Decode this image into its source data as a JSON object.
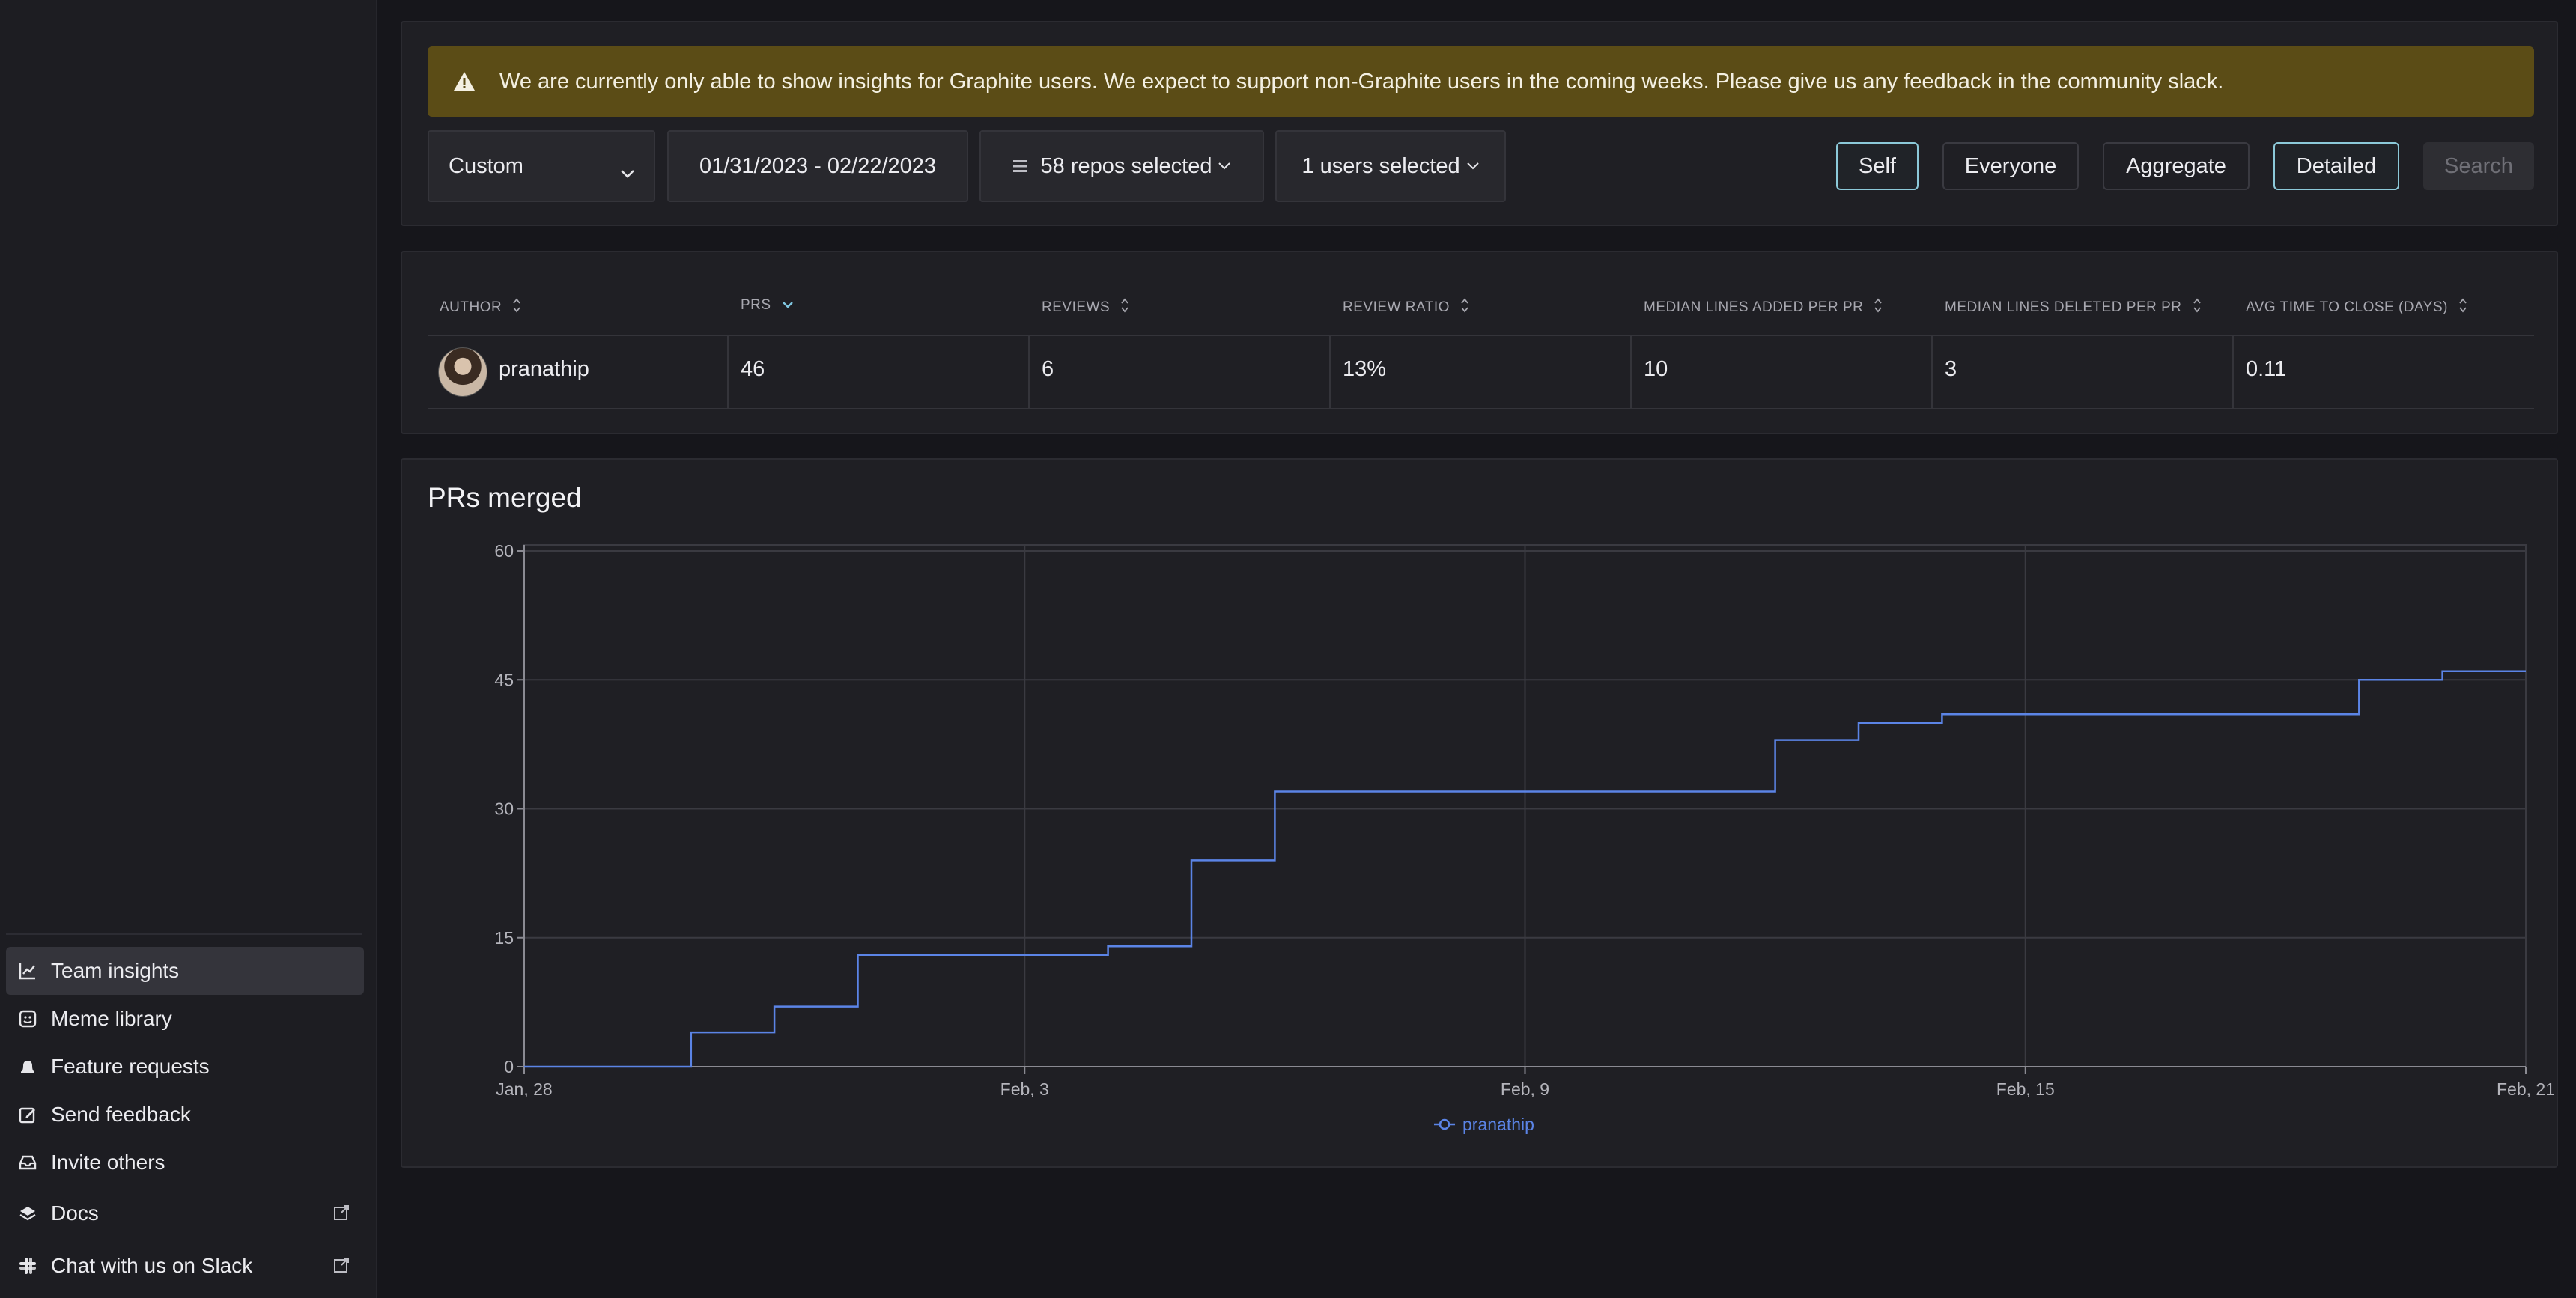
{
  "sidebar": {
    "items": [
      {
        "label": "Team insights",
        "icon": "chart-line-icon",
        "active": true
      },
      {
        "label": "Meme library",
        "icon": "meme-icon",
        "active": false
      },
      {
        "label": "Feature requests",
        "icon": "bell-icon",
        "active": false
      },
      {
        "label": "Send feedback",
        "icon": "edit-icon",
        "active": false
      },
      {
        "label": "Invite others",
        "icon": "inbox-icon",
        "active": false
      },
      {
        "label": "Docs",
        "icon": "layers-icon",
        "active": false,
        "external": true
      },
      {
        "label": "Chat with us on Slack",
        "icon": "slack-icon",
        "active": false,
        "external": true
      }
    ]
  },
  "banner": {
    "text": "We are currently only able to show insights for Graphite users. We expect to support non-Graphite users in the coming weeks. Please give us any feedback in the community slack.",
    "icon": "warning-icon",
    "color": "#5b4c16"
  },
  "filters": {
    "range_select": "Custom",
    "date_range": "01/31/2023 - 02/22/2023",
    "repos": "58 repos selected",
    "users": "1 users selected",
    "buttons": {
      "self": "Self",
      "everyone": "Everyone",
      "aggregate": "Aggregate",
      "detailed": "Detailed",
      "search": "Search"
    }
  },
  "table": {
    "headers": [
      "AUTHOR",
      "PRS",
      "REVIEWS",
      "REVIEW RATIO",
      "MEDIAN LINES ADDED PER PR",
      "MEDIAN LINES DELETED PER PR",
      "AVG TIME TO CLOSE (DAYS)"
    ],
    "rows": [
      {
        "author": "pranathip",
        "prs": "46",
        "reviews": "6",
        "review_ratio": "13%",
        "median_added": "10",
        "median_deleted": "3",
        "avg_close": "0.11"
      }
    ]
  },
  "chart": {
    "title": "PRs merged",
    "accent": "#5b84e6"
  },
  "chart_data": {
    "type": "line",
    "step": true,
    "title": "PRs merged",
    "xlabel": "",
    "ylabel": "",
    "x_ticks": [
      "Jan, 28",
      "Feb, 3",
      "Feb, 9",
      "Feb, 15",
      "Feb, 21"
    ],
    "y_ticks": [
      0,
      15,
      30,
      45,
      60
    ],
    "ylim": [
      0,
      60
    ],
    "grid": true,
    "legend_position": "bottom-center",
    "series": [
      {
        "name": "pranathip",
        "color": "#5b84e6",
        "points": [
          {
            "x": "2023-01-28",
            "y": 0
          },
          {
            "x": "2023-01-30",
            "y": 0
          },
          {
            "x": "2023-01-30",
            "y": 4
          },
          {
            "x": "2023-01-31",
            "y": 4
          },
          {
            "x": "2023-01-31",
            "y": 7
          },
          {
            "x": "2023-02-01",
            "y": 7
          },
          {
            "x": "2023-02-01",
            "y": 13
          },
          {
            "x": "2023-02-04",
            "y": 13
          },
          {
            "x": "2023-02-04",
            "y": 14
          },
          {
            "x": "2023-02-05",
            "y": 14
          },
          {
            "x": "2023-02-05",
            "y": 24
          },
          {
            "x": "2023-02-06",
            "y": 24
          },
          {
            "x": "2023-02-06",
            "y": 32
          },
          {
            "x": "2023-02-12",
            "y": 32
          },
          {
            "x": "2023-02-12",
            "y": 38
          },
          {
            "x": "2023-02-13",
            "y": 38
          },
          {
            "x": "2023-02-13",
            "y": 40
          },
          {
            "x": "2023-02-14",
            "y": 40
          },
          {
            "x": "2023-02-14",
            "y": 41
          },
          {
            "x": "2023-02-19",
            "y": 41
          },
          {
            "x": "2023-02-19",
            "y": 45
          },
          {
            "x": "2023-02-20",
            "y": 45
          },
          {
            "x": "2023-02-20",
            "y": 46
          },
          {
            "x": "2023-02-21",
            "y": 46
          }
        ]
      }
    ]
  }
}
